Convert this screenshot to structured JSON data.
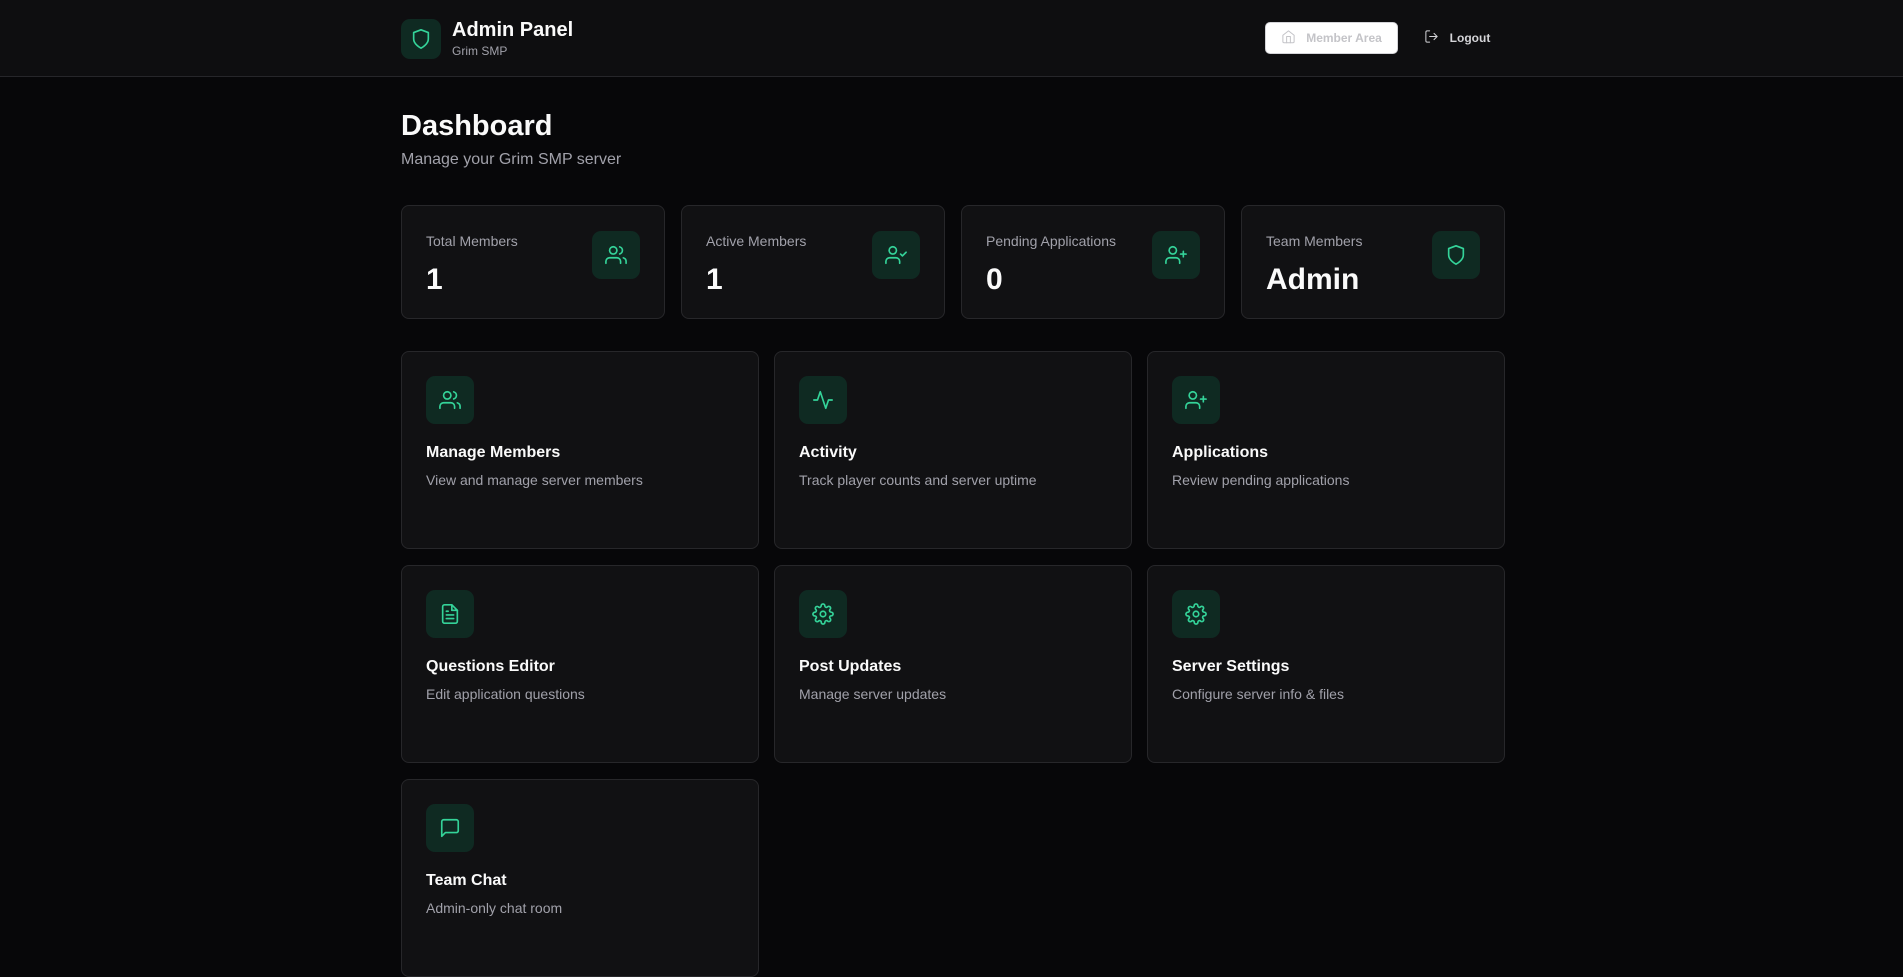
{
  "header": {
    "title": "Admin Panel",
    "subtitle": "Grim SMP",
    "member_area_label": "Member Area",
    "logout_label": "Logout"
  },
  "page": {
    "title": "Dashboard",
    "subtitle": "Manage your Grim SMP server"
  },
  "stats": [
    {
      "label": "Total Members",
      "value": "1",
      "icon": "users-icon"
    },
    {
      "label": "Active Members",
      "value": "1",
      "icon": "user-check-icon"
    },
    {
      "label": "Pending Applications",
      "value": "0",
      "icon": "user-plus-icon"
    },
    {
      "label": "Team Members",
      "value": "Admin",
      "icon": "shield-icon"
    }
  ],
  "cards": [
    {
      "title": "Manage Members",
      "description": "View and manage server members",
      "icon": "users-icon"
    },
    {
      "title": "Activity",
      "description": "Track player counts and server uptime",
      "icon": "activity-icon"
    },
    {
      "title": "Applications",
      "description": "Review pending applications",
      "icon": "user-plus-icon"
    },
    {
      "title": "Questions Editor",
      "description": "Edit application questions",
      "icon": "file-text-icon"
    },
    {
      "title": "Post Updates",
      "description": "Manage server updates",
      "icon": "gear-icon"
    },
    {
      "title": "Server Settings",
      "description": "Configure server info & files",
      "icon": "gear-icon"
    },
    {
      "title": "Team Chat",
      "description": "Admin-only chat room",
      "icon": "message-square-icon"
    }
  ],
  "colors": {
    "accent": "#34d399",
    "background": "#070709",
    "card": "#111113",
    "border": "#27272a"
  }
}
